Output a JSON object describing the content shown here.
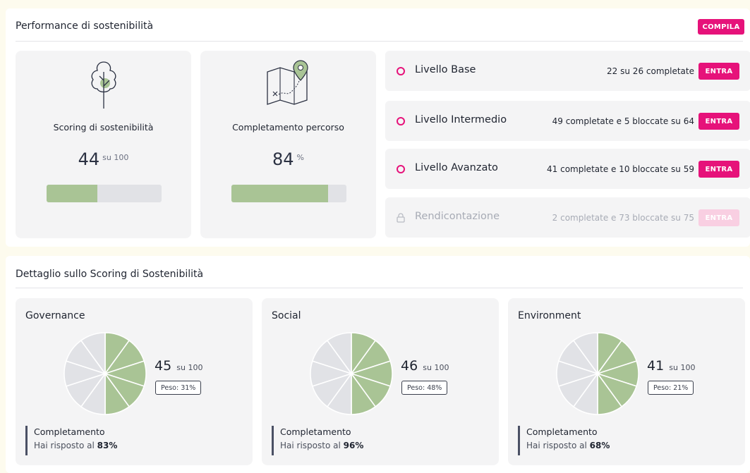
{
  "performance": {
    "title": "Performance di sostenibilità",
    "compile_label": "COMPILA",
    "scoring": {
      "label": "Scoring di sostenibilità",
      "value": "44",
      "unit": "su 100",
      "progress": 0.44,
      "icon": "tree-icon"
    },
    "completion": {
      "label": "Completamento percorso",
      "value": "84",
      "unit": "%",
      "progress": 0.84,
      "icon": "map-pin-icon"
    },
    "levels": [
      {
        "name": "Livello Base",
        "status": "22 su 26 completate",
        "button": "ENTRA",
        "locked": false
      },
      {
        "name": "Livello Intermedio",
        "status": "49 completate e 5 bloccate su 64",
        "button": "ENTRA",
        "locked": false
      },
      {
        "name": "Livello Avanzato",
        "status": "41 completate e 10 bloccate su 59",
        "button": "ENTRA",
        "locked": false
      },
      {
        "name": "Rendicontazione",
        "status": "2 completate e 73 bloccate su 75",
        "button": "ENTRA",
        "locked": true
      }
    ]
  },
  "detail": {
    "title": "Dettaglio sullo Scoring di Sostenibilità",
    "completion_title": "Completamento",
    "completion_prefix": "Hai risposto al",
    "pillars": [
      {
        "name": "Governance",
        "score": "45",
        "unit": "su 100",
        "weight": "Peso: 31%",
        "answered": "83%",
        "filled_slices": 5,
        "total_slices": 10
      },
      {
        "name": "Social",
        "score": "46",
        "unit": "su 100",
        "weight": "Peso: 48%",
        "answered": "96%",
        "filled_slices": 5,
        "total_slices": 10
      },
      {
        "name": "Environment",
        "score": "41",
        "unit": "su 100",
        "weight": "Peso: 21%",
        "answered": "68%",
        "filled_slices": 5,
        "total_slices": 10
      }
    ]
  },
  "colors": {
    "accent": "#e6127a",
    "progress_fill": "#a9c495",
    "progress_track": "#e1e2e6",
    "pie_filled": "#a9c495",
    "pie_empty": "#e1e2e6"
  }
}
